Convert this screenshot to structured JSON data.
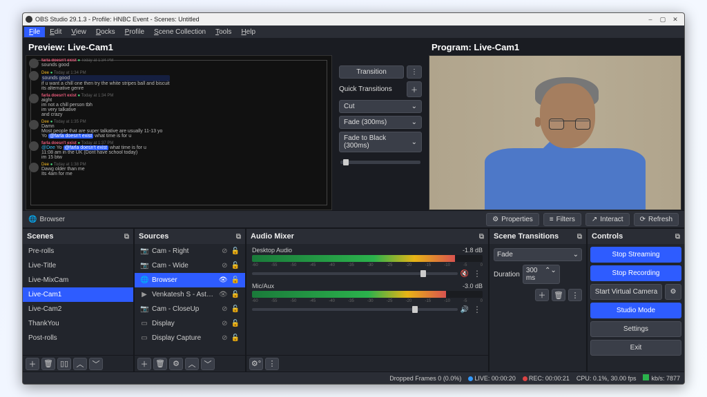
{
  "titlebar": {
    "text": "OBS Studio 29.1.3 - Profile: HNBC Event - Scenes: Untitled"
  },
  "menubar": [
    "File",
    "Edit",
    "View",
    "Docks",
    "Profile",
    "Scene Collection",
    "Tools",
    "Help"
  ],
  "preview_title": "Preview: Live-Cam1",
  "program_title": "Program: Live-Cam1",
  "chat": [
    {
      "name": "farla doesn't exist",
      "nameClass": "red",
      "time": "Today at 1:34 PM",
      "lines": [
        "sounds good"
      ]
    },
    {
      "name": "Dee",
      "nameClass": "yellow",
      "time": "Today at 1:34 PM",
      "lines": [
        "sounds good",
        "if u want a chill one then try the white stripes ball and biscuit",
        "its alternative genre"
      ],
      "selFirst": true
    },
    {
      "name": "farla doesn't exist",
      "nameClass": "red",
      "time": "Today at 1:34 PM",
      "lines": [
        "aight",
        "im not a chill person tbh",
        "im very talkative",
        "and crazy"
      ]
    },
    {
      "name": "Dee",
      "nameClass": "yellow",
      "time": "Today at 1:35 PM",
      "lines": [
        "Damn",
        "Most people that are super talkative are usually 11-13 yo",
        "Yo <tag>@farla doesn't exist</tag> what time is for u"
      ]
    },
    {
      "name": "farla doesn't exist",
      "nameClass": "red",
      "time": "Today at 1:37 PM",
      "lines": [
        "<cyan>@Dee</cyan> Yo <tag>@farla doesn't exist</tag> what time is for u",
        "11:08 am in the UK (Dont have school today)",
        "im 15 btw"
      ]
    },
    {
      "name": "Dee",
      "nameClass": "yellow",
      "time": "Today at 1:38 PM",
      "lines": [
        "Dawg older than me",
        "Its 4am for me"
      ]
    }
  ],
  "transition_btn": "Transition",
  "quick_transitions": "Quick Transitions",
  "qt_items": [
    "Cut",
    "Fade (300ms)",
    "Fade to Black (300ms)"
  ],
  "context": {
    "source": "Browser",
    "buttons": [
      "Properties",
      "Filters",
      "Interact",
      "Refresh"
    ]
  },
  "panels": {
    "scenes": {
      "title": "Scenes",
      "items": [
        "Pre-rolls",
        "Live-Title",
        "Live-MixCam",
        "Live-Cam1",
        "Live-Cam2",
        "ThankYou",
        "Post-rolls"
      ],
      "selected": "Live-Cam1"
    },
    "sources": {
      "title": "Sources",
      "items": [
        {
          "icon": "cam",
          "label": "Cam - Right",
          "vis": "off"
        },
        {
          "icon": "cam",
          "label": "Cam - Wide",
          "vis": "off"
        },
        {
          "icon": "globe",
          "label": "Browser",
          "vis": "on",
          "sel": true
        },
        {
          "icon": "play",
          "label": "Venkatesh S - Aston Ban…",
          "vis": "on"
        },
        {
          "icon": "cam",
          "label": "Cam - CloseUp",
          "vis": "off"
        },
        {
          "icon": "disp",
          "label": "Display",
          "vis": "off"
        },
        {
          "icon": "disp",
          "label": "Display Capture",
          "vis": "off"
        }
      ]
    },
    "mixer": {
      "title": "Audio Mixer",
      "tracks": [
        {
          "name": "Desktop Audio",
          "db": "-1.8 dB",
          "fill": 88,
          "vol": 82,
          "muted": true
        },
        {
          "name": "Mic/Aux",
          "db": "-3.0 dB",
          "fill": 84,
          "vol": 78,
          "muted": false
        }
      ],
      "ticks": [
        "-60",
        "-55",
        "-50",
        "-45",
        "-40",
        "-35",
        "-30",
        "-25",
        "-20",
        "-15",
        "-10",
        "-5",
        "0"
      ]
    },
    "transitions": {
      "title": "Scene Transitions",
      "type": "Fade",
      "duration_label": "Duration",
      "duration": "300 ms"
    },
    "controls": {
      "title": "Controls",
      "buttons": [
        {
          "label": "Stop Streaming",
          "style": "blue"
        },
        {
          "label": "Stop Recording",
          "style": "blue"
        },
        {
          "label": "Start Virtual Camera",
          "style": "gear"
        },
        {
          "label": "Studio Mode",
          "style": "blue"
        },
        {
          "label": "Settings",
          "style": "norm"
        },
        {
          "label": "Exit",
          "style": "norm"
        }
      ]
    }
  },
  "status": {
    "dropped": "Dropped Frames 0 (0.0%)",
    "live": "LIVE: 00:00:20",
    "rec": "REC: 00:00:21",
    "cpu": "CPU: 0.1%, 30.00 fps",
    "kbps": "kb/s: 7877"
  }
}
